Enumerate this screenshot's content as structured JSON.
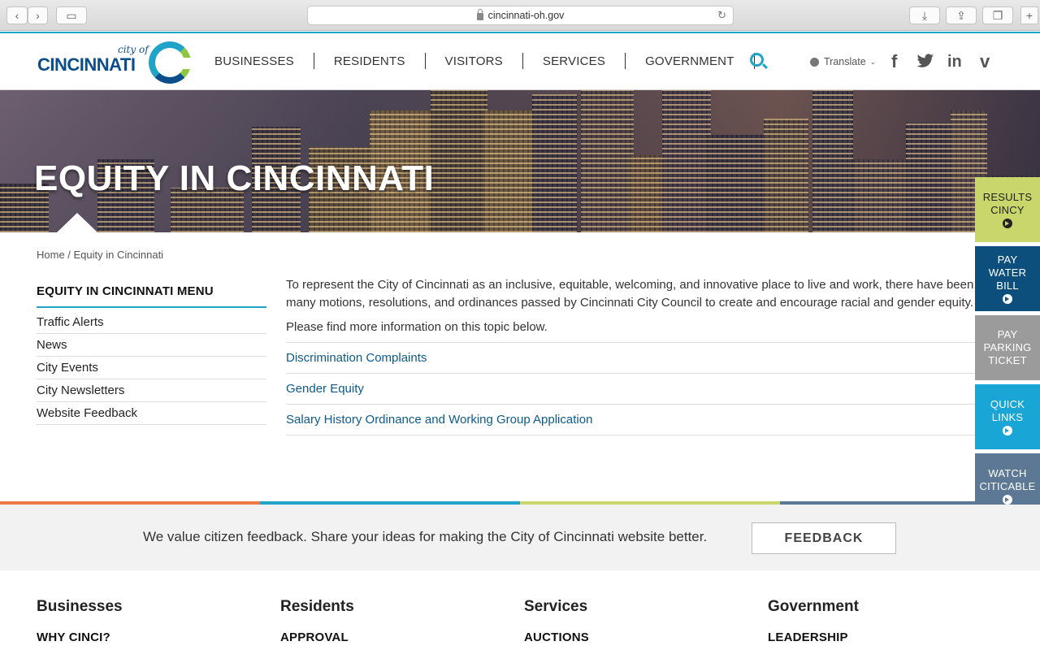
{
  "browser": {
    "url": "cincinnati-oh.gov"
  },
  "header": {
    "logo": {
      "city_of": "city of",
      "name": "CINCINNATI"
    },
    "nav": [
      "BUSINESSES",
      "RESIDENTS",
      "VISITORS",
      "SERVICES",
      "GOVERNMENT"
    ],
    "translate_label": "Translate",
    "social_glyphs": {
      "facebook": "f",
      "linkedin": "in",
      "vimeo": "v"
    }
  },
  "hero": {
    "title": "EQUITY IN CINCINNATI"
  },
  "tiles": [
    {
      "lines": [
        "RESULTS",
        "CINCY"
      ],
      "color": "#c9d66b",
      "text_color": "#222222"
    },
    {
      "lines": [
        "PAY",
        "WATER",
        "BILL"
      ],
      "color": "#0c4f7c",
      "text_color": "#ffffff"
    },
    {
      "lines": [
        "PAY",
        "PARKING",
        "TICKET"
      ],
      "color": "#9b9b9b",
      "text_color": "#ffffff"
    },
    {
      "lines": [
        "QUICK",
        "LINKS"
      ],
      "color": "#19a6d6",
      "text_color": "#ffffff"
    },
    {
      "lines": [
        "WATCH",
        "CITICABLE"
      ],
      "color": "#5d7895",
      "text_color": "#ffffff"
    }
  ],
  "breadcrumb": "Home / Equity in Cincinnati",
  "menu": {
    "title": "EQUITY IN CINCINNATI MENU",
    "items": [
      "Traffic Alerts",
      "News",
      "City Events",
      "City Newsletters",
      "Website Feedback"
    ]
  },
  "main": {
    "paragraph": "To represent the City of Cincinnati as an inclusive, equitable, welcoming, and innovative place to live and work, there have been many motions, resolutions, and ordinances passed by Cincinnati City Council to create and encourage racial and gender equity.",
    "intro": "Please find more information on this topic below.",
    "links": [
      "Discrimination Complaints",
      "Gender Equity",
      "Salary History Ordinance and Working Group Application"
    ]
  },
  "feedback": {
    "text": "We value citizen feedback. Share your ideas for making the City of Cincinnati website better.",
    "button": "FEEDBACK"
  },
  "footer": {
    "columns": [
      {
        "heading": "Businesses",
        "first_link": "WHY CINCI?"
      },
      {
        "heading": "Residents",
        "first_link": "APPROVAL"
      },
      {
        "heading": "Services",
        "first_link": "AUCTIONS"
      },
      {
        "heading": "Government",
        "first_link": "LEADERSHIP"
      }
    ]
  },
  "colors": {
    "accent": "#1fa3c9",
    "stripe": [
      "#ee7a45",
      "#1fa3c9",
      "#c9d66b",
      "#5d7895"
    ]
  }
}
